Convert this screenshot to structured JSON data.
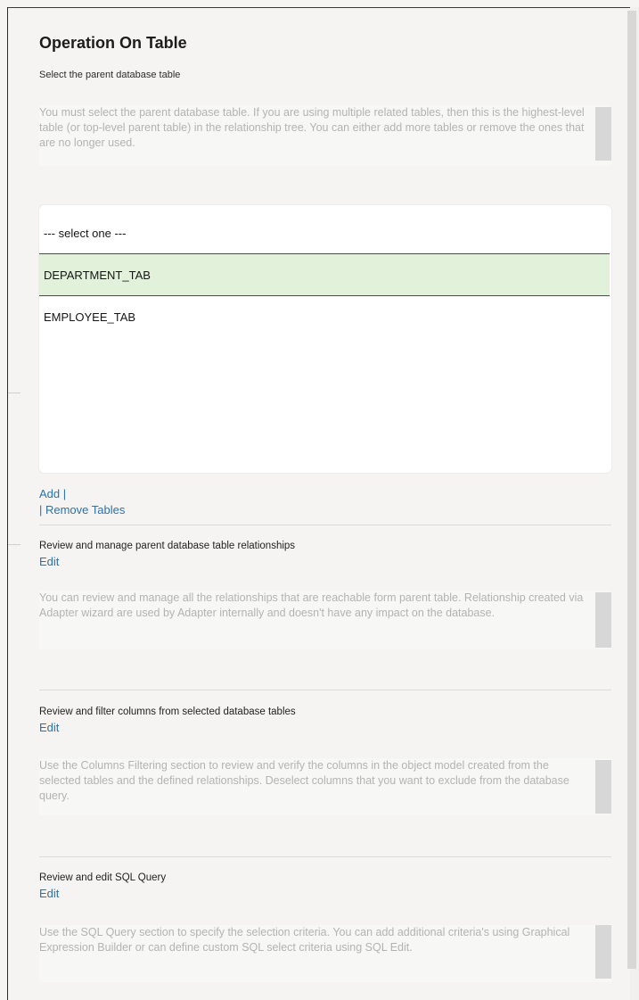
{
  "header": {
    "title": "Operation On Table",
    "subtitle": "Select the parent database table",
    "description": "You must select the parent database table. If you are using multiple related tables, then this is the highest-level table (or top-level parent table) in the relationship tree. You can either add more tables or remove the ones that are no longer used."
  },
  "table_select": {
    "placeholder": "--- select one ---",
    "options": [
      "DEPARTMENT_TAB",
      "EMPLOYEE_TAB"
    ],
    "selected": "DEPARTMENT_TAB"
  },
  "table_actions": {
    "add_label": "Add |",
    "remove_label": "| Remove Tables"
  },
  "sections": [
    {
      "label": "Review and manage parent database table relationships",
      "edit_label": "Edit",
      "description": "You can review and manage all the relationships that are reachable form parent table. Relationship created via Adapter wizard are used by Adapter internally and doesn't have any impact on the database."
    },
    {
      "label": "Review and filter columns from selected database tables",
      "edit_label": "Edit",
      "description": "Use the Columns Filtering section to review and verify the columns in the object model created from the selected tables and the defined relationships. Deselect columns that you want to exclude from the database query."
    },
    {
      "label": "Review and edit SQL Query",
      "edit_label": "Edit",
      "description": "Use the SQL Query section to specify the selection criteria. You can add additional criteria's using Graphical Expression Builder or can define custom SQL select criteria using SQL Edit."
    }
  ],
  "colors": {
    "link": "#2c72a8",
    "selected_row": "#e2f1da",
    "muted_text": "#b3b3b3"
  }
}
